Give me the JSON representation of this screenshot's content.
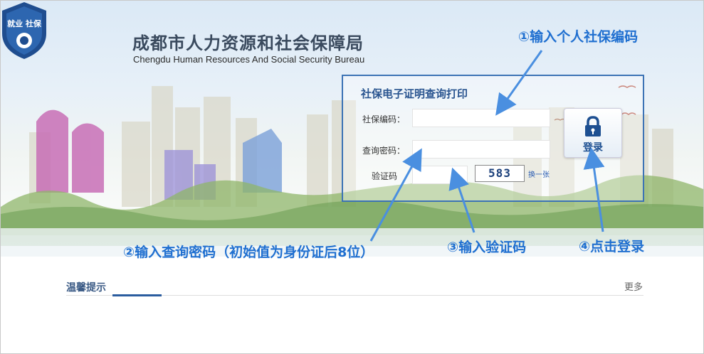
{
  "header": {
    "org_name_cn": "成都市人力资源和社会保障局",
    "org_name_en": "Chengdu Human Resources And Social Security Bureau",
    "logo_text": "就业 社保"
  },
  "login": {
    "title": "社保电子证明查询打印",
    "ss_number_label": "社保编码：",
    "password_label": "查询密码：",
    "captcha_label": "验证码",
    "captcha_value": "583",
    "refresh_label": "换一张",
    "login_button": "登录"
  },
  "annotations": {
    "step1": "①输入个人社保编码",
    "step2": "②输入查询密码（初始值为身份证后8位）",
    "step3": "③输入验证码",
    "step4": "④点击登录"
  },
  "notice": {
    "title": "温馨提示",
    "more": "更多"
  },
  "colors": {
    "annotation": "#1f6fd0",
    "box_border": "#3c73b5",
    "title": "#2a5590"
  }
}
